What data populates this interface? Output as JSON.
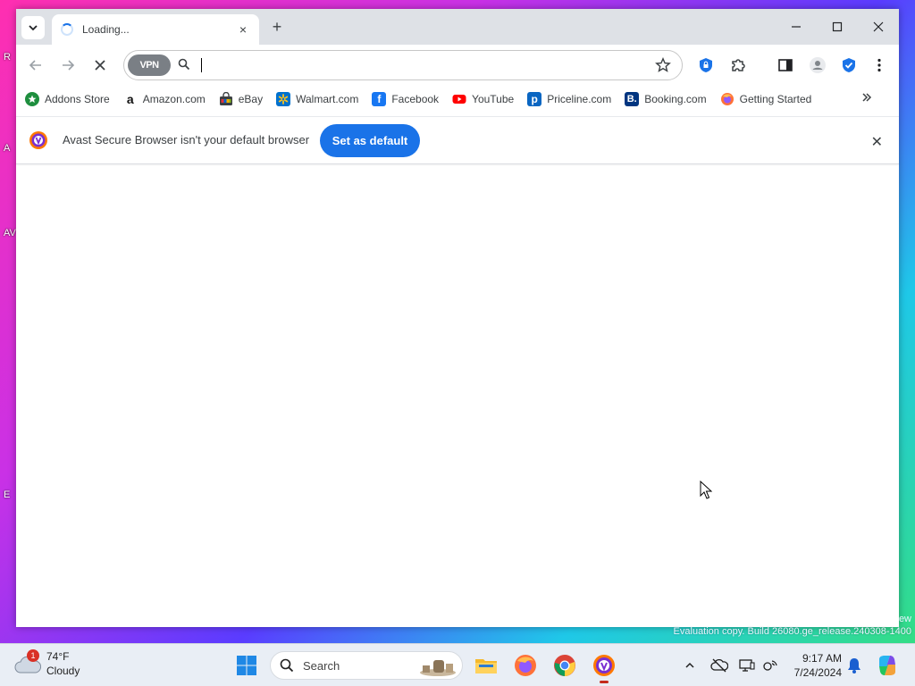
{
  "desktop": {
    "fragments": [
      "R",
      "A",
      "AV",
      "E"
    ]
  },
  "browser": {
    "tab": {
      "title": "Loading...",
      "close_label": "×"
    },
    "new_tab_label": "+",
    "window_controls": {
      "minimize": "—",
      "maximize": "☐",
      "close": "✕"
    },
    "toolbar": {
      "vpn_label": "VPN",
      "address_value": "",
      "address_placeholder": ""
    },
    "bookmarks": [
      {
        "label": "Addons Store",
        "icon": "addons-store-icon",
        "color": "#1e8e3e"
      },
      {
        "label": "Amazon.com",
        "icon": "amazon-icon",
        "color": "#111111"
      },
      {
        "label": "eBay",
        "icon": "ebay-icon",
        "color": "#e53238"
      },
      {
        "label": "Walmart.com",
        "icon": "walmart-icon",
        "color": "#0071ce"
      },
      {
        "label": "Facebook",
        "icon": "facebook-icon",
        "color": "#1877f2"
      },
      {
        "label": "YouTube",
        "icon": "youtube-icon",
        "color": "#ff0000"
      },
      {
        "label": "Priceline.com",
        "icon": "priceline-icon",
        "color": "#0a66c2"
      },
      {
        "label": "Booking.com",
        "icon": "booking-icon",
        "color": "#003580"
      },
      {
        "label": "Getting Started",
        "icon": "firefox-icon",
        "color": "#ff7139"
      }
    ],
    "infobar": {
      "message": "Avast Secure Browser isn't your default browser",
      "button_label": "Set as default",
      "close_label": "✕"
    }
  },
  "watermark": {
    "line1": "ew",
    "line2": "Evaluation copy. Build 26080.ge_release.240308-1400"
  },
  "taskbar": {
    "weather": {
      "temperature": "74°F",
      "condition": "Cloudy",
      "badge": "1"
    },
    "search_label": "Search",
    "clock": {
      "time": "9:17 AM",
      "date": "7/24/2024"
    }
  },
  "colors": {
    "accent": "#1a73e8",
    "tabstrip": "#dee1e6",
    "taskbar": "#e9eef5"
  }
}
